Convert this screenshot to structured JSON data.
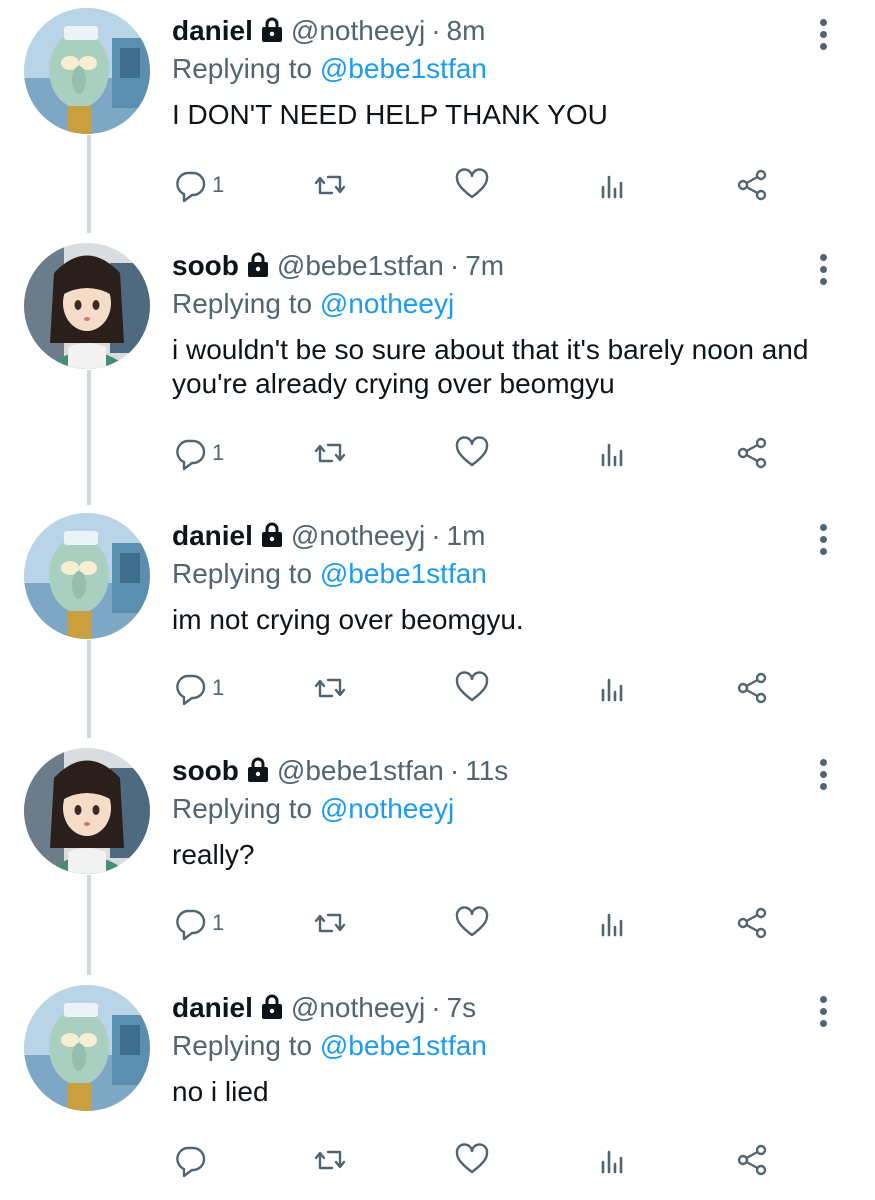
{
  "colors": {
    "accent": "#1d9bf0",
    "muted": "#536471",
    "text": "#0f1419",
    "thread_line": "#cfd9de"
  },
  "tweets": [
    {
      "name": "daniel",
      "handle": "@notheeyj",
      "sep": "·",
      "time": "8m",
      "replying_prefix": "Replying to",
      "replying_to": "@bebe1stfan",
      "text": "I DON'T NEED HELP THANK YOU",
      "reply_count": "1",
      "avatar_icon": "squidward-avatar-icon"
    },
    {
      "name": "soob",
      "handle": "@bebe1stfan",
      "sep": "·",
      "time": "7m",
      "replying_prefix": "Replying to",
      "replying_to": "@notheeyj",
      "text": "i wouldn't be so sure about that it's barely noon and you're already crying over beomgyu",
      "reply_count": "1",
      "avatar_icon": "anime-girl-avatar-icon"
    },
    {
      "name": "daniel",
      "handle": "@notheeyj",
      "sep": "·",
      "time": "1m",
      "replying_prefix": "Replying to",
      "replying_to": "@bebe1stfan",
      "text": "im not crying over beomgyu.",
      "reply_count": "1",
      "avatar_icon": "squidward-avatar-icon"
    },
    {
      "name": "soob",
      "handle": "@bebe1stfan",
      "sep": "·",
      "time": "11s",
      "replying_prefix": "Replying to",
      "replying_to": "@notheeyj",
      "text": "really?",
      "reply_count": "1",
      "avatar_icon": "anime-girl-avatar-icon"
    },
    {
      "name": "daniel",
      "handle": "@notheeyj",
      "sep": "·",
      "time": "7s",
      "replying_prefix": "Replying to",
      "replying_to": "@bebe1stfan",
      "text": "no i lied",
      "reply_count": "",
      "avatar_icon": "squidward-avatar-icon"
    }
  ]
}
